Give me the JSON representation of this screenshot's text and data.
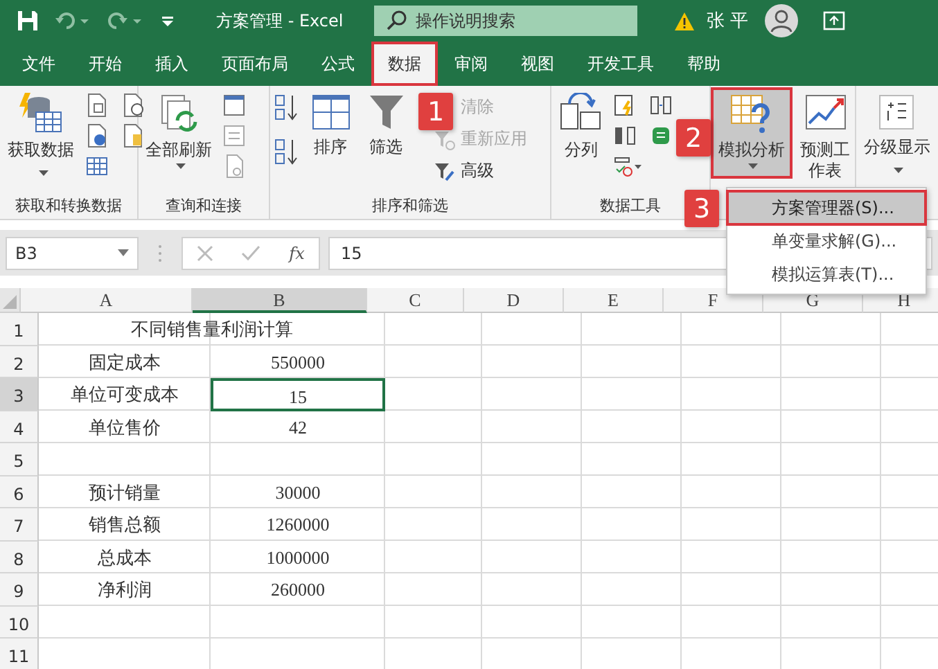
{
  "title_bar": {
    "title": "方案管理 - Excel",
    "search": {
      "placeholder": "操作说明搜索"
    },
    "user": "张 平"
  },
  "tabs": [
    {
      "label": "文件",
      "selected": false
    },
    {
      "label": "开始",
      "selected": false
    },
    {
      "label": "插入",
      "selected": false
    },
    {
      "label": "页面布局",
      "selected": false
    },
    {
      "label": "公式",
      "selected": false
    },
    {
      "label": "数据",
      "selected": true,
      "callout": "1"
    },
    {
      "label": "审阅",
      "selected": false
    },
    {
      "label": "视图",
      "selected": false
    },
    {
      "label": "开发工具",
      "selected": false
    },
    {
      "label": "帮助",
      "selected": false
    }
  ],
  "ribbon": {
    "groups": [
      {
        "label": "获取和转换数据",
        "buttons": [
          {
            "label": "获取数据",
            "dropdown": true
          }
        ]
      },
      {
        "label": "查询和连接",
        "buttons": [
          {
            "label": "全部刷新",
            "dropdown": true
          }
        ]
      },
      {
        "label": "排序和筛选",
        "buttons": [
          {
            "label": "排序",
            "disabled": false
          },
          {
            "label": "筛选",
            "disabled": false
          },
          {
            "label": "清除",
            "disabled": true
          },
          {
            "label": "重新应用",
            "disabled": true
          },
          {
            "label": "高级",
            "disabled": false
          }
        ]
      },
      {
        "label": "数据工具",
        "buttons": [
          {
            "label": "分列"
          }
        ]
      },
      {
        "buttons": [
          {
            "label": "模拟分析",
            "dropdown": true,
            "pressed": true,
            "callout": "2"
          },
          {
            "label": "预测工作表",
            "dropdown": false,
            "pressed": false
          }
        ]
      },
      {
        "buttons": [
          {
            "label": "分级显示",
            "dropdown": true
          }
        ]
      }
    ]
  },
  "formula_bar": {
    "name_box": "B3",
    "function_label": "fx",
    "value": "15"
  },
  "sheet": {
    "columns": [
      {
        "label": "A",
        "selected": false
      },
      {
        "label": "B",
        "selected": true
      },
      {
        "label": "C",
        "selected": false
      },
      {
        "label": "D",
        "selected": false
      },
      {
        "label": "E",
        "selected": false
      },
      {
        "label": "F",
        "selected": false
      },
      {
        "label": "G",
        "selected": false
      },
      {
        "label": "H",
        "selected": false
      }
    ],
    "rows": [
      {
        "header": "1",
        "selected": false,
        "kind": "merged",
        "cells": [
          "不同销售量利润计算"
        ]
      },
      {
        "header": "2",
        "selected": false,
        "kind": "normal",
        "cells": [
          "固定成本",
          "550000"
        ]
      },
      {
        "header": "3",
        "selected": true,
        "kind": "normal",
        "cells": [
          "单位可变成本",
          "15"
        ]
      },
      {
        "header": "4",
        "selected": false,
        "kind": "normal",
        "cells": [
          "单位售价",
          "42"
        ]
      },
      {
        "header": "5",
        "selected": false,
        "kind": "normal"
      },
      {
        "header": "6",
        "selected": false,
        "kind": "normal",
        "cells": [
          "预计销量",
          "30000"
        ]
      },
      {
        "header": "7",
        "selected": false,
        "kind": "normal",
        "cells": [
          "销售总额",
          "1260000"
        ]
      },
      {
        "header": "8",
        "selected": false,
        "kind": "normal",
        "cells": [
          "总成本",
          "1000000"
        ]
      },
      {
        "header": "9",
        "selected": false,
        "kind": "normal",
        "cells": [
          "净利润",
          "260000"
        ]
      },
      {
        "header": "10",
        "selected": false,
        "kind": "normal"
      },
      {
        "header": "11",
        "selected": false,
        "kind": "normal"
      }
    ]
  },
  "menu": {
    "items": [
      {
        "label": "方案管理器(S)...",
        "selected": true,
        "callout": "3"
      },
      {
        "label": "单变量求解(G)...",
        "selected": false
      },
      {
        "label": "模拟运算表(T)...",
        "selected": false
      }
    ]
  }
}
